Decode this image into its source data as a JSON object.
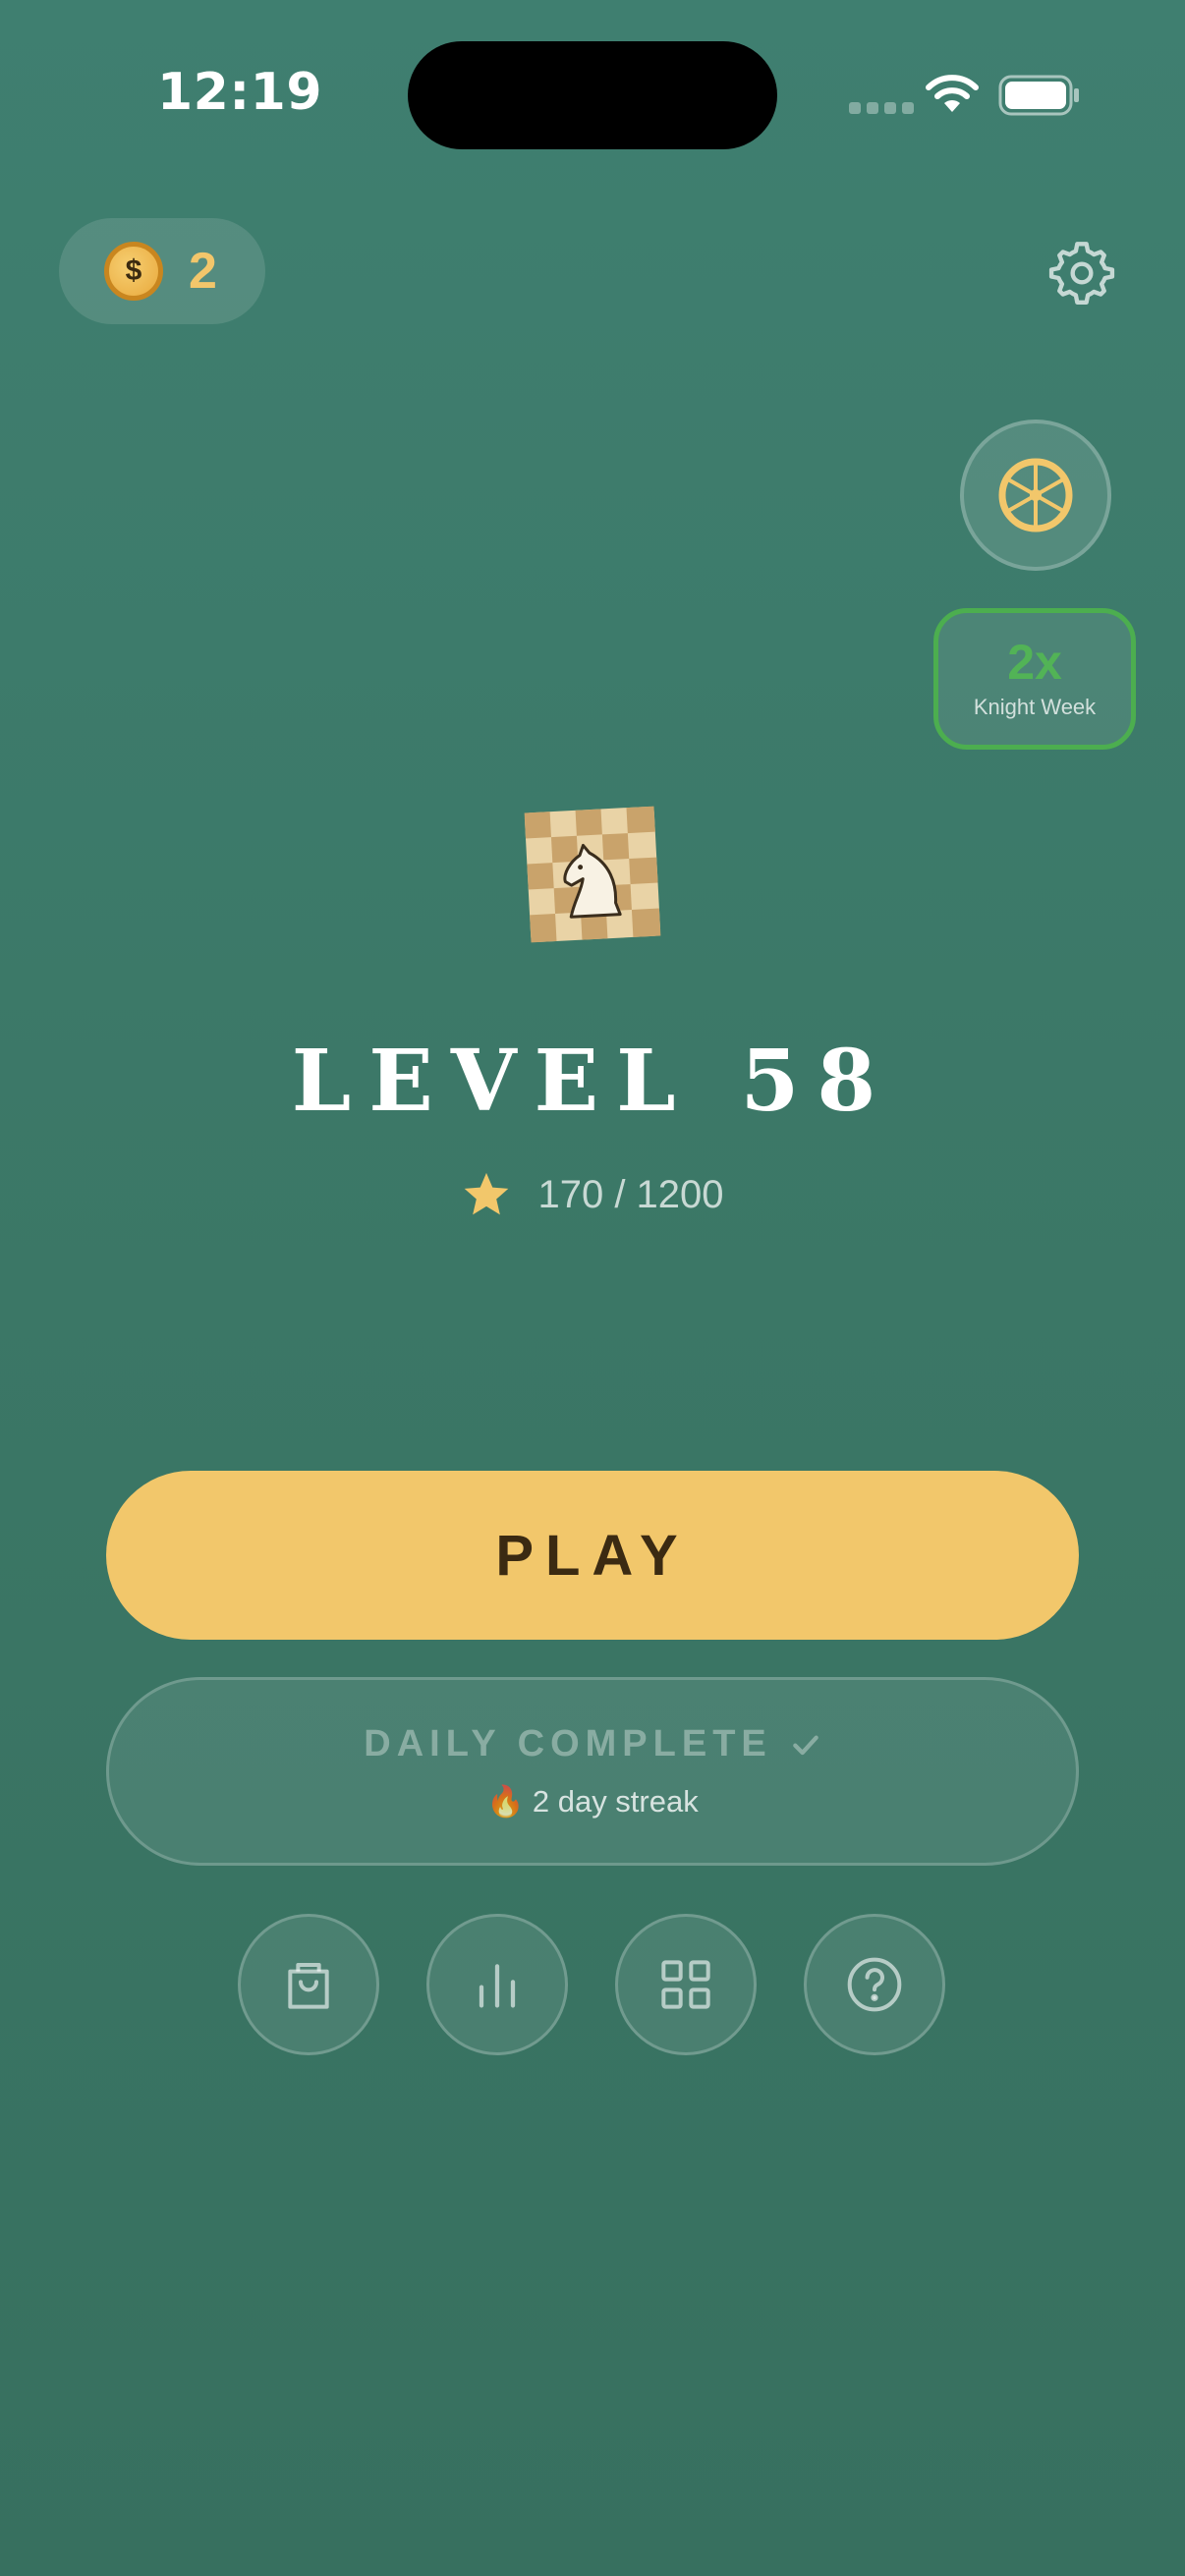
{
  "status_bar": {
    "time": "12:19"
  },
  "wallet": {
    "coin_symbol": "$",
    "coins": "2"
  },
  "boost": {
    "multiplier": "2x",
    "label": "Knight Week"
  },
  "level": {
    "title": "LEVEL 58",
    "stars_progress": "170 / 1200"
  },
  "actions": {
    "play_label": "PLAY",
    "daily_label": "DAILY COMPLETE",
    "streak_emoji": "🔥",
    "streak_text": "2 day streak"
  },
  "icons": [
    "settings-gear",
    "prize-wheel",
    "knight-board",
    "star",
    "checkmark",
    "shop-bag",
    "stats-bars",
    "grid",
    "help-question"
  ],
  "colors": {
    "background": "#3d7a6b",
    "accent": "#f2c76b",
    "boost_green": "#4cae4f"
  }
}
